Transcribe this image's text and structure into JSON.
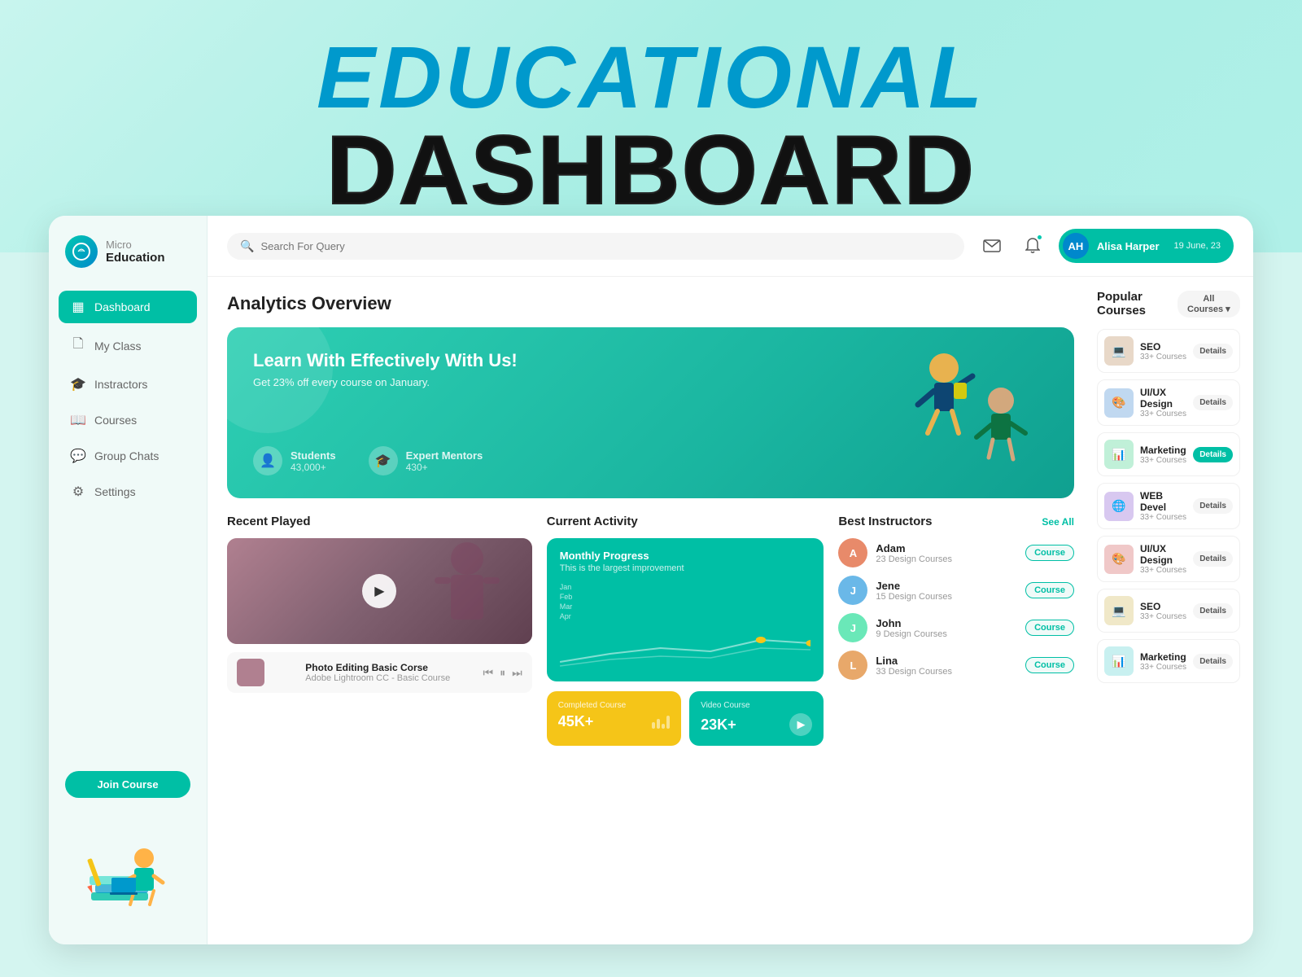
{
  "banner": {
    "line1": "EDUCATIONAL",
    "line2": "DASHBOARD"
  },
  "logo": {
    "name_line1": "Micro",
    "name_line2": "Education"
  },
  "nav": {
    "items": [
      {
        "id": "dashboard",
        "label": "Dashboard",
        "icon": "▦",
        "active": true
      },
      {
        "id": "my-class",
        "label": "My Class",
        "icon": "🗋",
        "active": false
      },
      {
        "id": "instructors",
        "label": "Instractors",
        "icon": "🎓",
        "active": false
      },
      {
        "id": "courses",
        "label": "Courses",
        "icon": "📖",
        "active": false
      },
      {
        "id": "group-chats",
        "label": "Group Chats",
        "icon": "💬",
        "active": false
      },
      {
        "id": "settings",
        "label": "Settings",
        "icon": "⚙",
        "active": false
      }
    ],
    "join_course_label": "Join Course"
  },
  "topbar": {
    "search_placeholder": "Search For Query",
    "user_name": "Alisa Harper",
    "user_date": "19 June, 23"
  },
  "hero": {
    "title": "Learn With Effectively With Us!",
    "subtitle": "Get 23% off every course on January.",
    "stats": [
      {
        "label": "Students",
        "value": "43,000+",
        "icon": "👤"
      },
      {
        "label": "Expert Mentors",
        "value": "430+",
        "icon": "🎓"
      }
    ]
  },
  "analytics_title": "Analytics Overview",
  "recent_played": {
    "title": "Recent Played",
    "video_title": "Photo Editing Basic Corse",
    "video_subtitle": "Adobe Lightroom CC - Basic Course"
  },
  "current_activity": {
    "title": "Current Activity",
    "card_title": "Monthly Progress",
    "card_subtitle": "This is the largest improvement",
    "months": [
      "Jan",
      "Feb",
      "Mar",
      "Apr"
    ],
    "stats": [
      {
        "number": "45K+",
        "label": "Completed Course",
        "color": "yellow"
      },
      {
        "number": "23K+",
        "label": "Video Course",
        "color": "teal"
      }
    ]
  },
  "best_instructors": {
    "title": "Best Instructors",
    "see_all": "See All",
    "items": [
      {
        "name": "Adam",
        "sub": "23 Design Courses",
        "color": "#e88a6a",
        "badge": "Course"
      },
      {
        "name": "Jene",
        "sub": "15 Design Courses",
        "color": "#6ab8e8",
        "badge": "Course"
      },
      {
        "name": "John",
        "sub": "9 Design Courses",
        "color": "#6ae8b8",
        "badge": "Course"
      },
      {
        "name": "Lina",
        "sub": "33 Design Courses",
        "color": "#e8a86a",
        "badge": "Course"
      }
    ]
  },
  "popular_courses": {
    "title": "Popular Courses",
    "filter_label": "All Courses ▾",
    "items": [
      {
        "name": "SEO",
        "count": "33+ Courses",
        "color": "#e8d0b8",
        "icon": "💻",
        "details": "Details",
        "active": false
      },
      {
        "name": "UI/UX Design",
        "count": "33+ Courses",
        "color": "#b8d0e8",
        "icon": "🎨",
        "details": "Details",
        "active": false
      },
      {
        "name": "Marketing",
        "count": "33+ Courses",
        "color": "#b8e8d0",
        "icon": "📊",
        "details": "Details",
        "active": true
      },
      {
        "name": "WEB Devel",
        "count": "33+ Courses",
        "color": "#c8b8e8",
        "icon": "🌐",
        "details": "Details",
        "active": false
      },
      {
        "name": "UI/UX Design",
        "count": "33+ Courses",
        "color": "#e8b8b8",
        "icon": "🎨",
        "details": "Details",
        "active": false
      },
      {
        "name": "SEO",
        "count": "33+ Courses",
        "color": "#e8d8b8",
        "icon": "💻",
        "details": "Details",
        "active": false
      },
      {
        "name": "Marketing",
        "count": "33+ Courses",
        "color": "#b8e8e8",
        "icon": "📊",
        "details": "Details",
        "active": false
      }
    ]
  }
}
